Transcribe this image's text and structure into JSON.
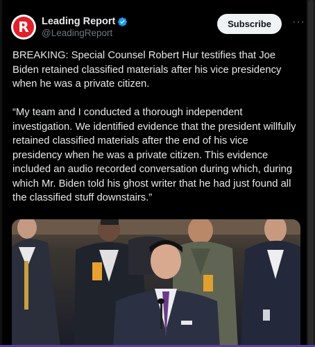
{
  "post": {
    "display_name": "Leading Report",
    "handle": "@LeadingReport",
    "avatar_letter": "R",
    "subscribe_label": "Subscribe",
    "more_label": "···",
    "paragraph1": "BREAKING: Special Counsel Robert Hur testifies that Joe Biden retained classified materials after his vice presidency when he was a private citizen.",
    "paragraph2": "“My team and I conducted a thorough independent investigation. We identified evidence that the president willfully retained classified materials after the end of his vice presidency when he was a private citizen. This evidence included an audio recorded conversation during which, during which Mr. Biden told his ghost writer that he had just found all the classified stuff downstairs.”"
  },
  "colors": {
    "background": "#000000",
    "text": "#e7e9ea",
    "secondary_text": "#71767b",
    "verified_blue": "#1d9bf0",
    "brand_red": "#e0202a",
    "subscribe_bg": "#eff3f4"
  },
  "icons": {
    "verified": "verified-badge-icon",
    "more": "more-options-icon"
  }
}
